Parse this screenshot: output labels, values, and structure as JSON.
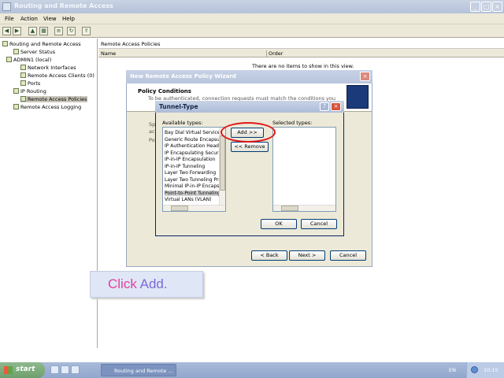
{
  "window": {
    "title": "Routing and Remote Access",
    "controls": [
      "_",
      "□",
      "×"
    ]
  },
  "menu": [
    "File",
    "Action",
    "View",
    "Help"
  ],
  "toolbar": {
    "icons": [
      "back-icon",
      "forward-icon",
      "up-icon",
      "console-tree-icon",
      "properties-icon",
      "refresh-icon",
      "export-icon"
    ]
  },
  "tree": {
    "root": "Routing and Remote Access",
    "items": [
      {
        "label": "Server Status"
      },
      {
        "label": "ADMIN1 (local)"
      },
      {
        "label": "Network Interfaces"
      },
      {
        "label": "Remote Access Clients (0)"
      },
      {
        "label": "Ports"
      },
      {
        "label": "IP Routing"
      },
      {
        "label": "Remote Access Policies"
      },
      {
        "label": "Remote Access Logging"
      }
    ]
  },
  "rightpane": {
    "header": "Remote Access Policies",
    "columns": [
      "Name",
      "Order"
    ],
    "empty_text": "There are no items to show in this view."
  },
  "wizard": {
    "title": "New Remote Access Policy Wizard",
    "heading": "Policy Conditions",
    "subheading": "To be authenticated, connection requests must match the conditions you specify.",
    "frag1": "Sp",
    "frag2": "ac",
    "frag3": "Po",
    "back": "< Back",
    "next": "Next >",
    "cancel": "Cancel"
  },
  "dialog": {
    "title": "Tunnel-Type",
    "help": "?",
    "close": "×",
    "available_label": "Available types:",
    "selected_label": "Selected types:",
    "available_types": [
      "Bay Dial Virtual Services",
      "Generic Route Encapsulation",
      "IP Authentication Header",
      "IP Encapsulating Security",
      "IP-in-IP Encapsulation",
      "IP-in-IP Tunneling",
      "Layer Two Forwarding",
      "Layer Two Tunneling Protocol",
      "Minimal IP-in-IP Encapsulation",
      "Point-to-Point Tunneling",
      "Virtual LANs (VLAN)"
    ],
    "highlighted_index": 9,
    "add": "Add >>",
    "remove": "<< Remove",
    "ok": "OK",
    "cancel": "Cancel"
  },
  "callout": {
    "word1": "Click",
    "word2": "Add."
  },
  "taskbar": {
    "start": "start",
    "task": "Routing and Remote ...",
    "lang": "EN",
    "clock": "10:15"
  },
  "colors": {
    "highlight_ring": "#e01818",
    "callout_text": "#e0409a",
    "callout_accent": "#7a6ad6"
  }
}
